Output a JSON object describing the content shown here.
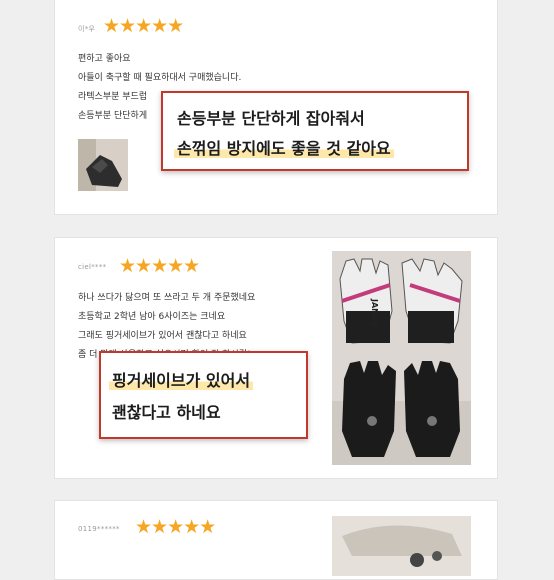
{
  "reviews": [
    {
      "author": "이*우",
      "stars": "★★★★★",
      "lines": [
        "편하고 좋아요",
        "아들이 축구할 때 필요하대서 구매했습니다.",
        "라텍스부분 부드럽",
        "손등부분 단단하게"
      ],
      "callout": {
        "line1": "손등부분 단단하게 잡아줘서",
        "line2": "손꺾임 방지에도 좋을 것 같아요"
      }
    },
    {
      "author": "ciel****",
      "stars": "★★★★★",
      "lines": [
        "하나 쓰다가 닳으며 또 쓰라고 두 개 주문했네요",
        "초등학교 2학년 남아 6사이즈는 크네요",
        "그래도 핑거세이브가 있어서 괜찮다고 하네요",
        "좀 더 맞게 사용하고 싶으시면 확인 잘 하시길!"
      ],
      "glove_brand_top": "JANUS",
      "callout": {
        "line1": "핑거세이브가 있어서",
        "line2": "괜찮다고 하네요"
      }
    },
    {
      "author": "0119******",
      "stars": "★★★★★"
    }
  ],
  "colors": {
    "star": "#f6a623",
    "callout_border": "#c0392b",
    "highlight": "#fde7a9"
  }
}
